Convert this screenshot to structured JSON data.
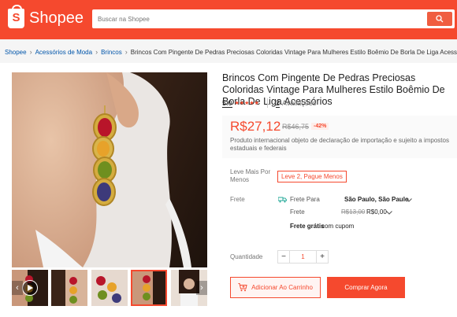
{
  "header": {
    "logo_text": "Shopee",
    "logo_mark": "S",
    "search_placeholder": "Buscar na Shopee",
    "brand_color": "#f5492e"
  },
  "breadcrumb": [
    "Shopee",
    "Acessórios de Moda",
    "Brincos",
    "Brincos Com Pingente De Pedras Preciosas Coloridas Vintage Para Mulheres Estilo Boêmio De Borla De Liga Acessórios"
  ],
  "product": {
    "title": "Brincos Com Pingente De Pedras Preciosas Coloridas Vintage Para Mulheres Estilo Boêmio De Borla De Liga Acessórios",
    "rating": "5.0",
    "stars": "★★★★★",
    "review_count": "2",
    "review_label": "Avaliações",
    "price": "R$27,12",
    "old_price": "R$46,75",
    "discount": "-42%",
    "import_note": "Produto internacional objeto de declaração de importação e sujeito a impostos estaduais e federais",
    "promo_label": "Leve Mais Por Menos",
    "promo_tag": "Leve 2, Pague Menos",
    "shipping_label": "Frete",
    "ship_to_label": "Frete Para",
    "ship_to_value": "São Paulo, São Paulo",
    "ship_cost_label": "Frete",
    "ship_old_cost": "R$13,00",
    "ship_cost": "R$0,00",
    "free_shipping_strong": "Frete grátis",
    "free_shipping_rest": "com cupom",
    "quantity_label": "Quantidade",
    "quantity_value": "1",
    "qty_minus": "−",
    "qty_plus": "+",
    "add_to_cart": "Adicionar Ao Carrinho",
    "buy_now": "Comprar Agora"
  },
  "thumb_nav": {
    "prev": "‹",
    "next": "›"
  }
}
